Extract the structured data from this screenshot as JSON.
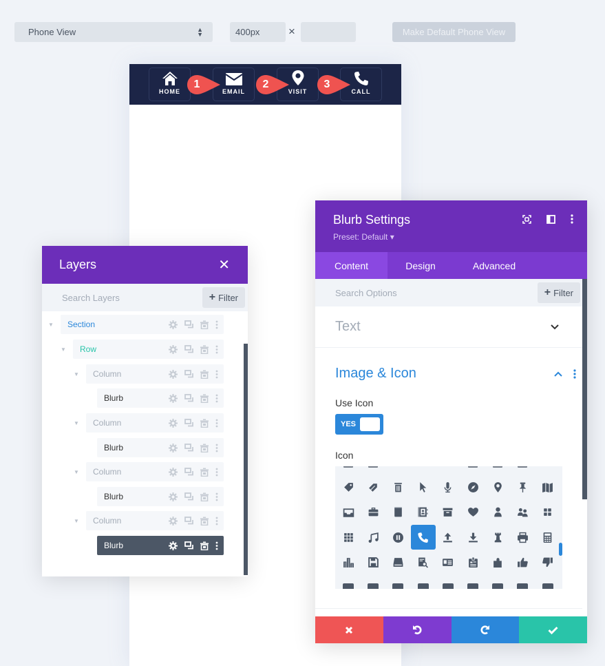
{
  "toolbar": {
    "view_select": "Phone View",
    "width_value": "400px",
    "times": "×",
    "height_value": "",
    "make_default_label": "Make Default Phone View"
  },
  "preview": {
    "nav_items": [
      {
        "label": "HOME",
        "icon": "home-icon"
      },
      {
        "label": "EMAIL",
        "icon": "envelope-icon"
      },
      {
        "label": "VISIT",
        "icon": "map-pin-icon"
      },
      {
        "label": "CALL",
        "icon": "phone-icon"
      }
    ],
    "markers": [
      "1",
      "2",
      "3"
    ],
    "colors": {
      "navbar": "#1c2547",
      "marker": "#ef5350"
    }
  },
  "layers": {
    "title": "Layers",
    "search_placeholder": "Search Layers",
    "filter_label": "Filter",
    "items": [
      {
        "label": "Section",
        "level": 0,
        "color": "#2b87da"
      },
      {
        "label": "Row",
        "level": 1,
        "color": "#29c4a9"
      },
      {
        "label": "Column",
        "level": 2,
        "color": "#a4acb7"
      },
      {
        "label": "Blurb",
        "level": 3,
        "color": "#333333"
      },
      {
        "label": "Column",
        "level": 2,
        "color": "#a4acb7"
      },
      {
        "label": "Blurb",
        "level": 3,
        "color": "#333333"
      },
      {
        "label": "Column",
        "level": 2,
        "color": "#a4acb7"
      },
      {
        "label": "Blurb",
        "level": 3,
        "color": "#333333"
      },
      {
        "label": "Column",
        "level": 2,
        "color": "#a4acb7"
      },
      {
        "label": "Blurb",
        "level": 3,
        "color": "#ffffff",
        "active": true
      }
    ]
  },
  "blurb": {
    "title": "Blurb Settings",
    "preset": "Preset: Default ▾",
    "tabs": [
      {
        "label": "Content",
        "active": true
      },
      {
        "label": "Design"
      },
      {
        "label": "Advanced"
      }
    ],
    "search_placeholder": "Search Options",
    "filter_label": "Filter",
    "sections": {
      "text_title": "Text",
      "image_icon_title": "Image & Icon"
    },
    "use_icon_label": "Use Icon",
    "use_icon_value": "YES",
    "icon_label": "Icon",
    "selected_icon": "phone-icon",
    "icon_rows": [
      [
        "tag-icon",
        "tags-icon",
        "trash-icon",
        "cursor-icon",
        "microphone-icon",
        "compass-icon",
        "map-pin-icon",
        "pushpin-icon",
        "map-icon"
      ],
      [
        "inbox-icon",
        "briefcase-icon",
        "book-icon",
        "address-book-icon",
        "archive-icon",
        "heart-icon",
        "user-icon",
        "users-icon",
        "grid-2x2-icon"
      ],
      [
        "grid-3x3-icon",
        "music-icon",
        "pause-icon",
        "phone-icon",
        "upload-icon",
        "download-icon",
        "chess-rook-icon",
        "printer-icon",
        "calculator-icon"
      ],
      [
        "building-icon",
        "floppy-icon",
        "hard-drive-icon",
        "document-search-icon",
        "id-card-icon",
        "id-badge-icon",
        "puzzle-icon",
        "thumbs-up-icon",
        "thumbs-down-icon"
      ]
    ],
    "colors": {
      "header": "#6c2eb9",
      "tabs": "#7b3ad0",
      "accent": "#2b87da",
      "discard": "#ef5555",
      "undo": "#7e3bd0",
      "redo": "#2b87da",
      "save": "#29c4a9"
    },
    "footer": {
      "discard": "close-icon",
      "undo": "undo-icon",
      "redo": "redo-icon",
      "save": "check-icon"
    }
  }
}
